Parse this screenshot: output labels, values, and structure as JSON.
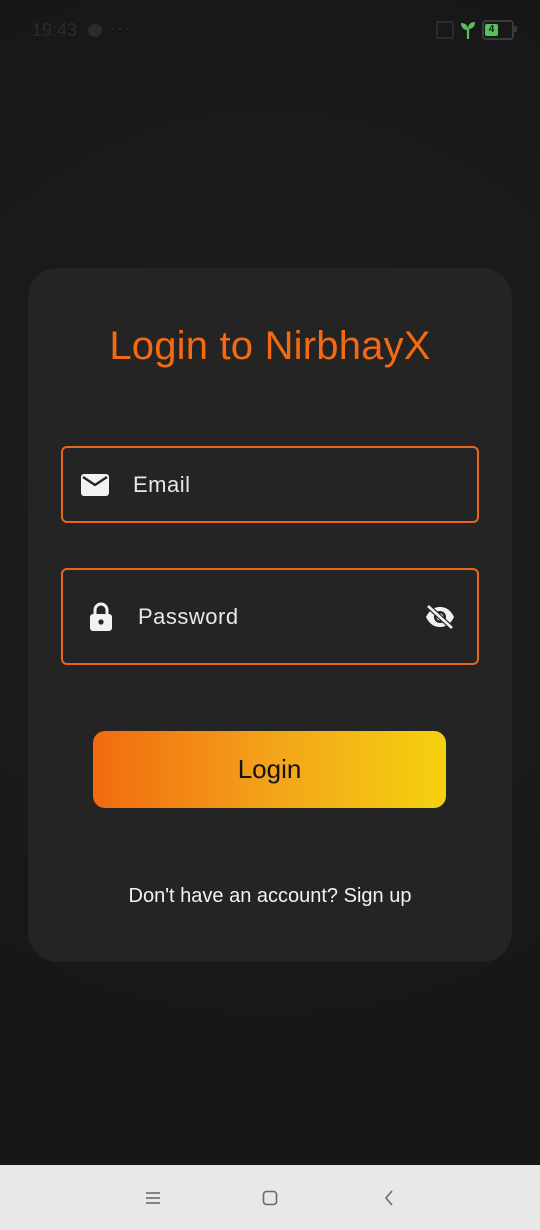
{
  "status_bar": {
    "time": "19:43",
    "dots": "···",
    "battery_level": "4",
    "icons": [
      "chat-bubble-icon",
      "nfc-icon",
      "sprout-icon",
      "battery-icon"
    ],
    "sprout_color": "#58c15c",
    "battery_color": "#58c15c"
  },
  "login": {
    "title": "Login to NirbhayX",
    "email_placeholder": "Email",
    "email_value": "",
    "password_placeholder": "Password",
    "password_value": "",
    "button_label": "Login",
    "signup_prompt": "Don't have an account? Sign up",
    "accent_color": "#f26a12",
    "gradient": [
      "#f26a10",
      "#f4d10e"
    ],
    "icons": {
      "email": "mail-icon",
      "password": "lock-icon",
      "toggle": "eye-off-icon"
    }
  },
  "nav_bar": {
    "icons": [
      "menu-icon",
      "home-square-icon",
      "back-chevron-icon"
    ]
  }
}
